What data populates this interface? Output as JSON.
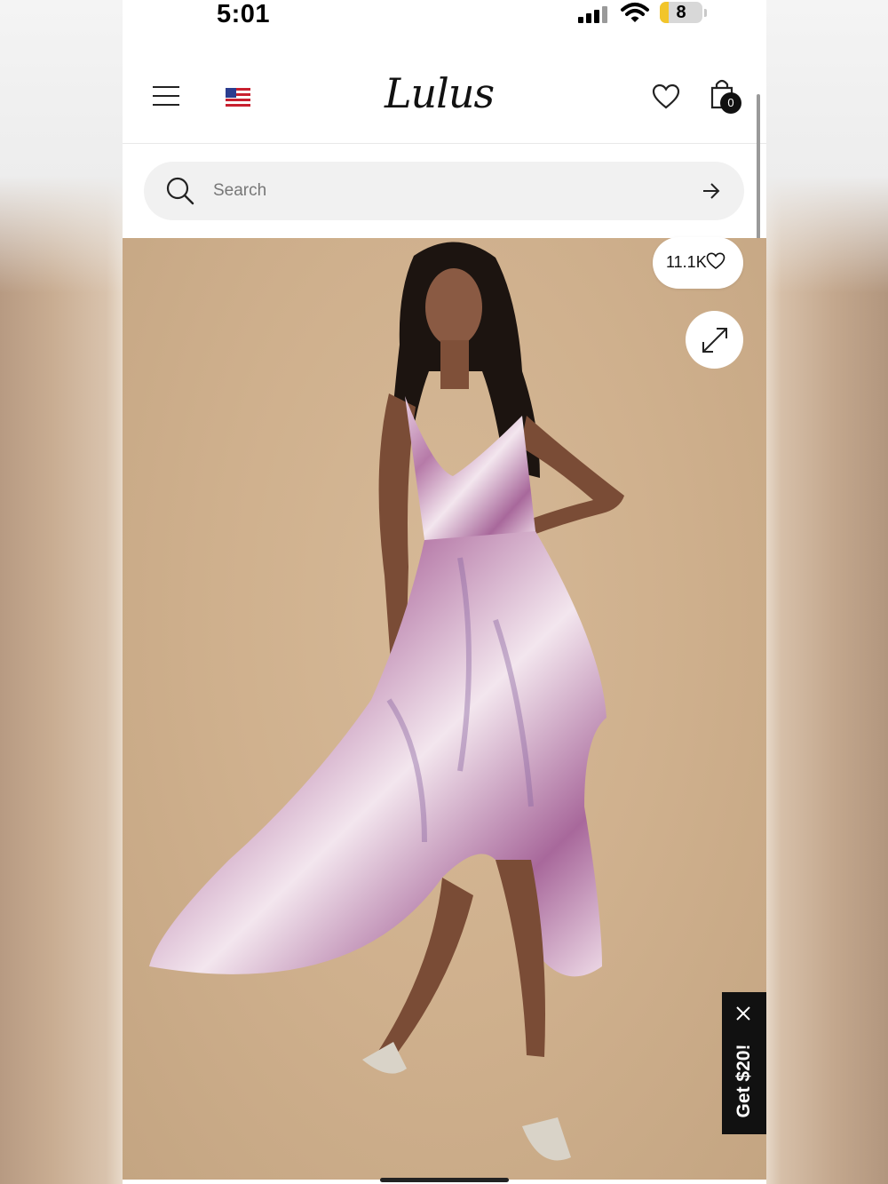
{
  "status_bar": {
    "time": "5:01",
    "battery": "8",
    "icons": [
      "signal-icon",
      "wifi-icon",
      "battery-icon"
    ]
  },
  "header": {
    "logo_text": "Lulus",
    "bag_count": "0",
    "icons": [
      "menu-icon",
      "us-flag-icon",
      "heart-icon",
      "shopping-bag-icon"
    ]
  },
  "search": {
    "placeholder": "Search"
  },
  "product": {
    "likes": "11.1K",
    "dress_colors": [
      "#b678a6",
      "#f2e4ee",
      "#8d6aa3"
    ]
  },
  "promo": {
    "label": "Get $20!"
  },
  "colors": {
    "background": "#ffffff",
    "image_bg": "#cfb08d",
    "promo_bg": "#111111"
  }
}
